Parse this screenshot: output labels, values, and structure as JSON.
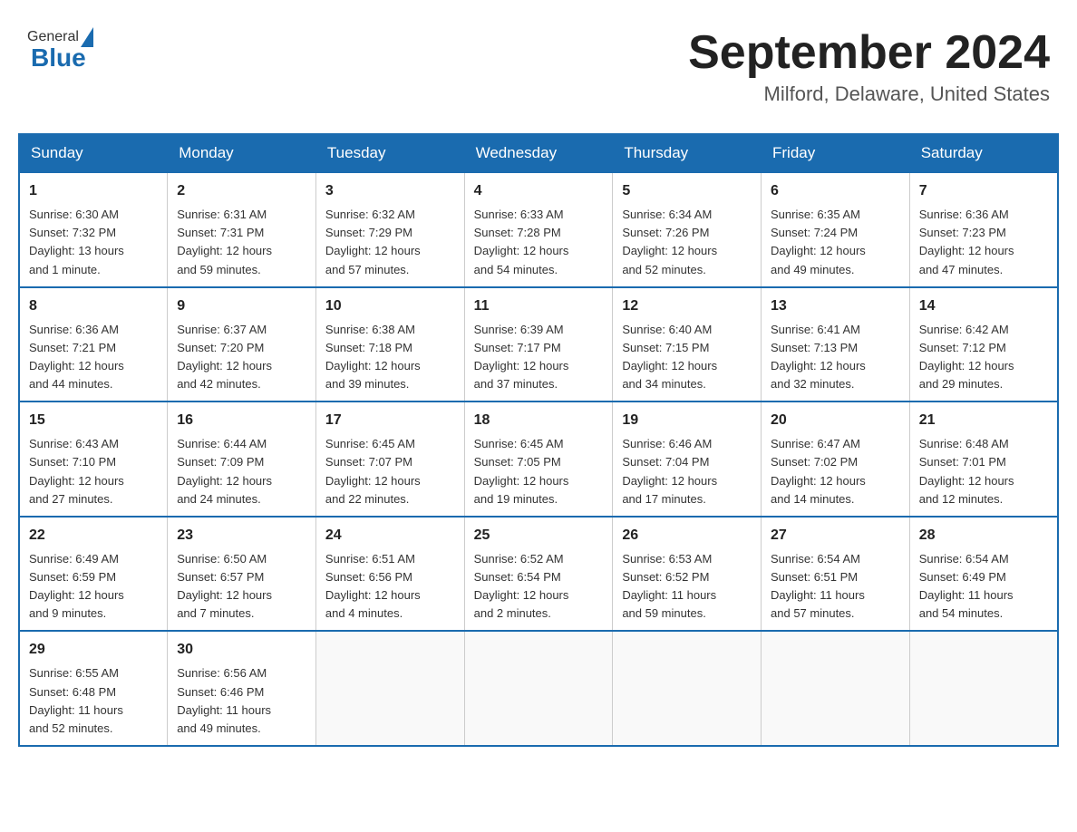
{
  "header": {
    "logo": {
      "general": "General",
      "blue": "Blue"
    },
    "title": "September 2024",
    "location": "Milford, Delaware, United States"
  },
  "days_of_week": [
    "Sunday",
    "Monday",
    "Tuesday",
    "Wednesday",
    "Thursday",
    "Friday",
    "Saturday"
  ],
  "weeks": [
    [
      {
        "day": "1",
        "sunrise": "6:30 AM",
        "sunset": "7:32 PM",
        "daylight": "13 hours and 1 minute."
      },
      {
        "day": "2",
        "sunrise": "6:31 AM",
        "sunset": "7:31 PM",
        "daylight": "12 hours and 59 minutes."
      },
      {
        "day": "3",
        "sunrise": "6:32 AM",
        "sunset": "7:29 PM",
        "daylight": "12 hours and 57 minutes."
      },
      {
        "day": "4",
        "sunrise": "6:33 AM",
        "sunset": "7:28 PM",
        "daylight": "12 hours and 54 minutes."
      },
      {
        "day": "5",
        "sunrise": "6:34 AM",
        "sunset": "7:26 PM",
        "daylight": "12 hours and 52 minutes."
      },
      {
        "day": "6",
        "sunrise": "6:35 AM",
        "sunset": "7:24 PM",
        "daylight": "12 hours and 49 minutes."
      },
      {
        "day": "7",
        "sunrise": "6:36 AM",
        "sunset": "7:23 PM",
        "daylight": "12 hours and 47 minutes."
      }
    ],
    [
      {
        "day": "8",
        "sunrise": "6:36 AM",
        "sunset": "7:21 PM",
        "daylight": "12 hours and 44 minutes."
      },
      {
        "day": "9",
        "sunrise": "6:37 AM",
        "sunset": "7:20 PM",
        "daylight": "12 hours and 42 minutes."
      },
      {
        "day": "10",
        "sunrise": "6:38 AM",
        "sunset": "7:18 PM",
        "daylight": "12 hours and 39 minutes."
      },
      {
        "day": "11",
        "sunrise": "6:39 AM",
        "sunset": "7:17 PM",
        "daylight": "12 hours and 37 minutes."
      },
      {
        "day": "12",
        "sunrise": "6:40 AM",
        "sunset": "7:15 PM",
        "daylight": "12 hours and 34 minutes."
      },
      {
        "day": "13",
        "sunrise": "6:41 AM",
        "sunset": "7:13 PM",
        "daylight": "12 hours and 32 minutes."
      },
      {
        "day": "14",
        "sunrise": "6:42 AM",
        "sunset": "7:12 PM",
        "daylight": "12 hours and 29 minutes."
      }
    ],
    [
      {
        "day": "15",
        "sunrise": "6:43 AM",
        "sunset": "7:10 PM",
        "daylight": "12 hours and 27 minutes."
      },
      {
        "day": "16",
        "sunrise": "6:44 AM",
        "sunset": "7:09 PM",
        "daylight": "12 hours and 24 minutes."
      },
      {
        "day": "17",
        "sunrise": "6:45 AM",
        "sunset": "7:07 PM",
        "daylight": "12 hours and 22 minutes."
      },
      {
        "day": "18",
        "sunrise": "6:45 AM",
        "sunset": "7:05 PM",
        "daylight": "12 hours and 19 minutes."
      },
      {
        "day": "19",
        "sunrise": "6:46 AM",
        "sunset": "7:04 PM",
        "daylight": "12 hours and 17 minutes."
      },
      {
        "day": "20",
        "sunrise": "6:47 AM",
        "sunset": "7:02 PM",
        "daylight": "12 hours and 14 minutes."
      },
      {
        "day": "21",
        "sunrise": "6:48 AM",
        "sunset": "7:01 PM",
        "daylight": "12 hours and 12 minutes."
      }
    ],
    [
      {
        "day": "22",
        "sunrise": "6:49 AM",
        "sunset": "6:59 PM",
        "daylight": "12 hours and 9 minutes."
      },
      {
        "day": "23",
        "sunrise": "6:50 AM",
        "sunset": "6:57 PM",
        "daylight": "12 hours and 7 minutes."
      },
      {
        "day": "24",
        "sunrise": "6:51 AM",
        "sunset": "6:56 PM",
        "daylight": "12 hours and 4 minutes."
      },
      {
        "day": "25",
        "sunrise": "6:52 AM",
        "sunset": "6:54 PM",
        "daylight": "12 hours and 2 minutes."
      },
      {
        "day": "26",
        "sunrise": "6:53 AM",
        "sunset": "6:52 PM",
        "daylight": "11 hours and 59 minutes."
      },
      {
        "day": "27",
        "sunrise": "6:54 AM",
        "sunset": "6:51 PM",
        "daylight": "11 hours and 57 minutes."
      },
      {
        "day": "28",
        "sunrise": "6:54 AM",
        "sunset": "6:49 PM",
        "daylight": "11 hours and 54 minutes."
      }
    ],
    [
      {
        "day": "29",
        "sunrise": "6:55 AM",
        "sunset": "6:48 PM",
        "daylight": "11 hours and 52 minutes."
      },
      {
        "day": "30",
        "sunrise": "6:56 AM",
        "sunset": "6:46 PM",
        "daylight": "11 hours and 49 minutes."
      },
      null,
      null,
      null,
      null,
      null
    ]
  ]
}
